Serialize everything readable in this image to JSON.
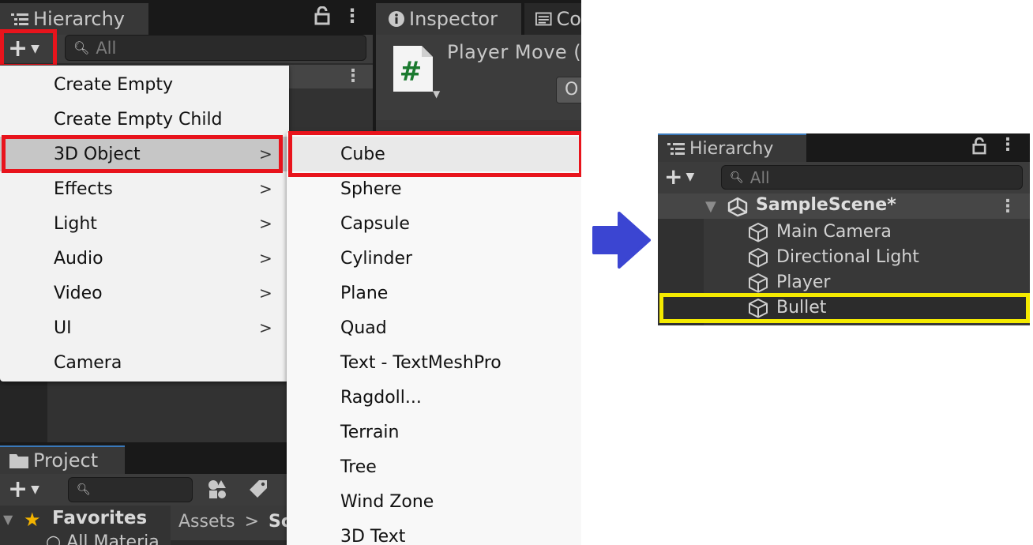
{
  "left_editor": {
    "hierarchy_tab": {
      "label": "Hierarchy"
    },
    "search_placeholder": "All",
    "inspector_tab": {
      "label": "Inspector"
    },
    "console_tab": {
      "label": "Co"
    },
    "inspector_title": "Player Move (",
    "inspector_button": "O",
    "project_tab": {
      "label": "Project"
    },
    "favorites_label": "Favorites",
    "favorites_item": "All Materia",
    "assets_breadcrumb": {
      "root": "Assets",
      "separator": ">",
      "next": "Sc"
    },
    "create_menu": {
      "items": [
        {
          "label": "Create Empty",
          "submenu": false
        },
        {
          "label": "Create Empty Child",
          "submenu": false
        },
        {
          "label": "3D Object",
          "submenu": true
        },
        {
          "label": "Effects",
          "submenu": true
        },
        {
          "label": "Light",
          "submenu": true
        },
        {
          "label": "Audio",
          "submenu": true
        },
        {
          "label": "Video",
          "submenu": true
        },
        {
          "label": "UI",
          "submenu": true
        },
        {
          "label": "Camera",
          "submenu": false
        }
      ],
      "arrow_glyph": ">"
    },
    "object_submenu": {
      "items": [
        "Cube",
        "Sphere",
        "Capsule",
        "Cylinder",
        "Plane",
        "Quad",
        "Text - TextMeshPro",
        "Ragdoll...",
        "Terrain",
        "Tree",
        "Wind Zone",
        "3D Text"
      ]
    }
  },
  "right_hierarchy": {
    "tab_label": "Hierarchy",
    "search_placeholder": "All",
    "scene_name": "SampleScene*",
    "objects": [
      "Main Camera",
      "Directional Light",
      "Player",
      "Bullet"
    ]
  },
  "colors": {
    "highlight_red": "#e8141c",
    "highlight_yellow": "#f4ea00",
    "arrow_blue": "#3b45d2"
  }
}
